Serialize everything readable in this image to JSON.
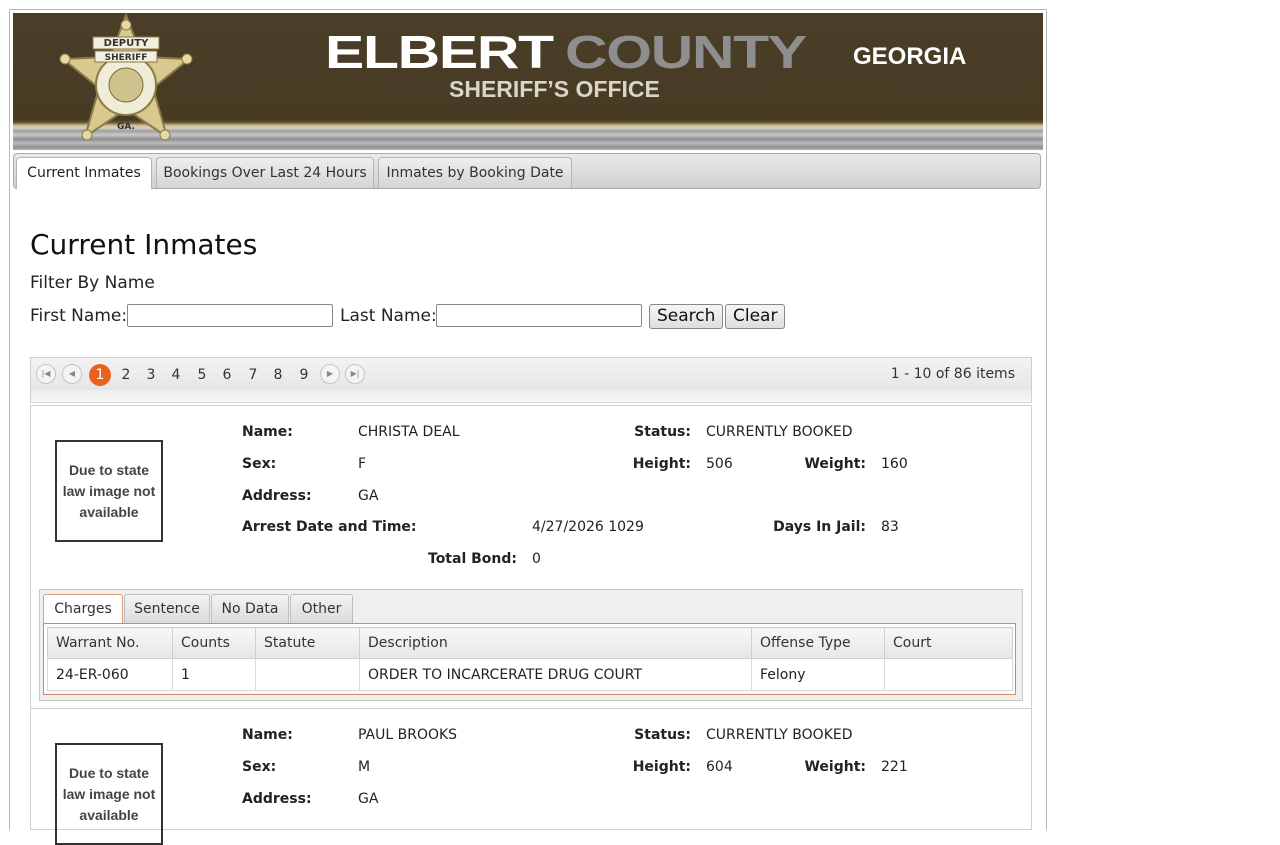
{
  "header": {
    "title_part1": "ELBERT",
    "title_part2": "COUNTY",
    "state": "GEORGIA",
    "subtitle": "SHERIFF’S OFFICE",
    "badge_top": "DEPUTY",
    "badge_mid": "SHERIFF",
    "badge_bottom": "GA."
  },
  "page_tabs": [
    {
      "label": "Current Inmates",
      "active": true
    },
    {
      "label": "Bookings Over Last 24 Hours",
      "active": false
    },
    {
      "label": "Inmates by Booking Date",
      "active": false
    }
  ],
  "main": {
    "heading": "Current Inmates",
    "filter_title": "Filter By Name",
    "first_name_label": "First Name:",
    "first_name_value": "",
    "last_name_label": "Last Name:",
    "last_name_value": "",
    "search_label": "Search",
    "clear_label": "Clear"
  },
  "pager": {
    "pages": [
      "1",
      "2",
      "3",
      "4",
      "5",
      "6",
      "7",
      "8",
      "9"
    ],
    "current_page": "1",
    "info": "1 - 10 of 86 items"
  },
  "labels": {
    "name": "Name:",
    "status": "Status:",
    "sex": "Sex:",
    "height": "Height:",
    "weight": "Weight:",
    "address": "Address:",
    "arrest": "Arrest Date and Time:",
    "days": "Days In Jail:",
    "bond": "Total Bond:",
    "no_image": "Due to state law image not available"
  },
  "detail_tabs": [
    "Charges",
    "Sentence",
    "No Data",
    "Other"
  ],
  "charge_columns": [
    "Warrant No.",
    "Counts",
    "Statute",
    "Description",
    "Offense Type",
    "Court"
  ],
  "inmates": [
    {
      "name": "CHRISTA DEAL",
      "status": "CURRENTLY BOOKED",
      "sex": "F",
      "height": "506",
      "weight": "160",
      "address": "GA",
      "arrest": "4/27/2026 1029",
      "days": "83",
      "bond": "0",
      "charges": [
        {
          "warrant": "24-ER-060",
          "counts": "1",
          "statute": "",
          "description": "ORDER TO INCARCERATE DRUG COURT",
          "offense_type": "Felony",
          "court": ""
        }
      ]
    },
    {
      "name": "PAUL BROOKS",
      "status": "CURRENTLY BOOKED",
      "sex": "M",
      "height": "604",
      "weight": "221",
      "address": "GA"
    }
  ]
}
